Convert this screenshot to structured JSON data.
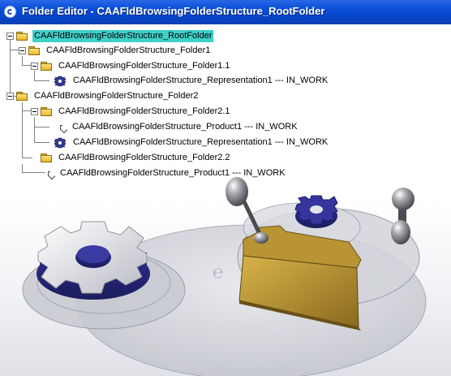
{
  "window": {
    "title": "Folder Editor - CAAFldBrowsingFolderStructure_RootFolder"
  },
  "tree": {
    "root": "CAAFldBrowsingFolderStructure_RootFolder",
    "folder1": "CAAFldBrowsingFolderStructure_Folder1",
    "folder1_1": "CAAFldBrowsingFolderStructure_Folder1.1",
    "representation1_a": "CAAFldBrowsingFolderStructure_Representation1 --- IN_WORK",
    "folder2": "CAAFldBrowsingFolderStructure_Folder2",
    "folder2_1": "CAAFldBrowsingFolderStructure_Folder2.1",
    "product1_a": "CAAFldBrowsingFolderStructure_Product1 --- IN_WORK",
    "representation1_b": "CAAFldBrowsingFolderStructure_Representation1 --- IN_WORK",
    "folder2_2": "CAAFldBrowsingFolderStructure_Folder2.2",
    "product1_b": "CAAFldBrowsingFolderStructure_Product1 --- IN_WORK"
  },
  "icons": {
    "app": "catia-app-icon",
    "folder": "folder-icon",
    "gear": "gear-icon",
    "product": "product-icon"
  },
  "colors": {
    "titlebar": "#0a4fd8",
    "selection": "#3fd0c8",
    "gear_blue": "#2e2e8e",
    "folder_gold": "#c7a53a"
  }
}
